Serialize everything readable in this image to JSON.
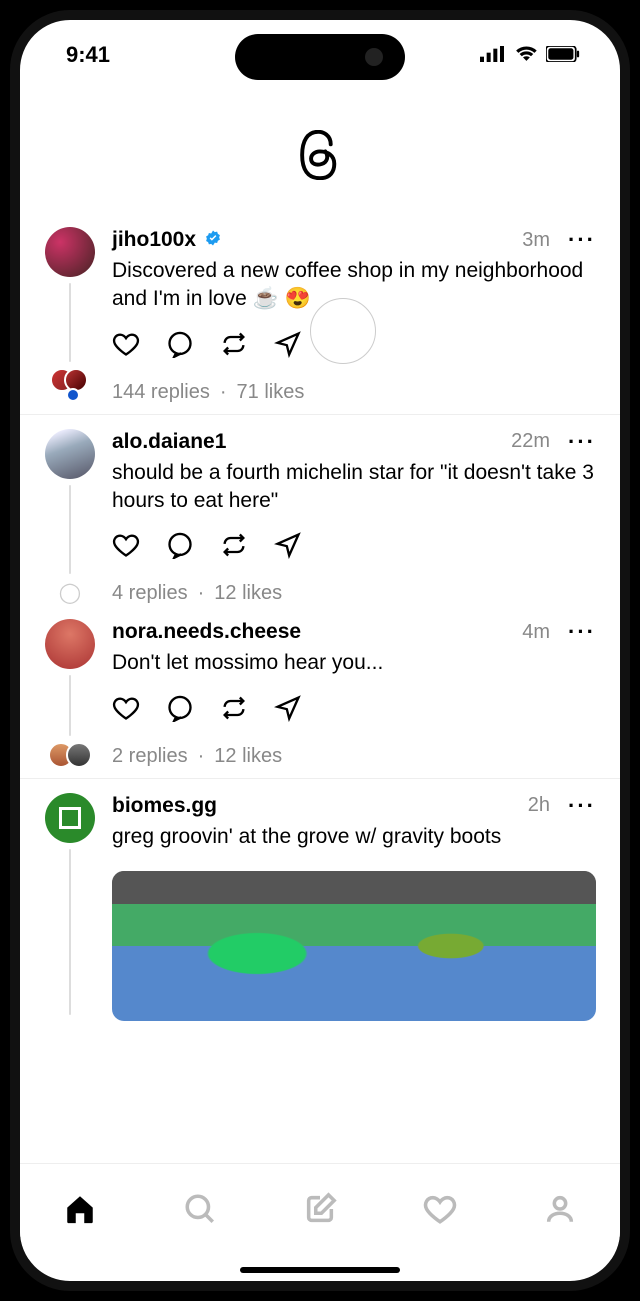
{
  "status": {
    "time": "9:41"
  },
  "posts": [
    {
      "user": "jiho100x",
      "verified": true,
      "time": "3m",
      "text": "Discovered a new coffee shop in my neighborhood and I'm in love ☕ 😍",
      "replies": "144 replies",
      "likes": "71 likes"
    },
    {
      "user": "alo.daiane1",
      "verified": false,
      "time": "22m",
      "text": "should be a fourth michelin star for \"it doesn't take 3 hours to eat here\"",
      "replies": "4 replies",
      "likes": "12 likes"
    },
    {
      "user": "nora.needs.cheese",
      "verified": false,
      "time": "4m",
      "text": "Don't let mossimo hear you...",
      "replies": "2 replies",
      "likes": "12 likes"
    },
    {
      "user": "biomes.gg",
      "verified": false,
      "time": "2h",
      "text": "greg groovin' at the grove w/ gravity boots"
    }
  ],
  "sep": "·"
}
